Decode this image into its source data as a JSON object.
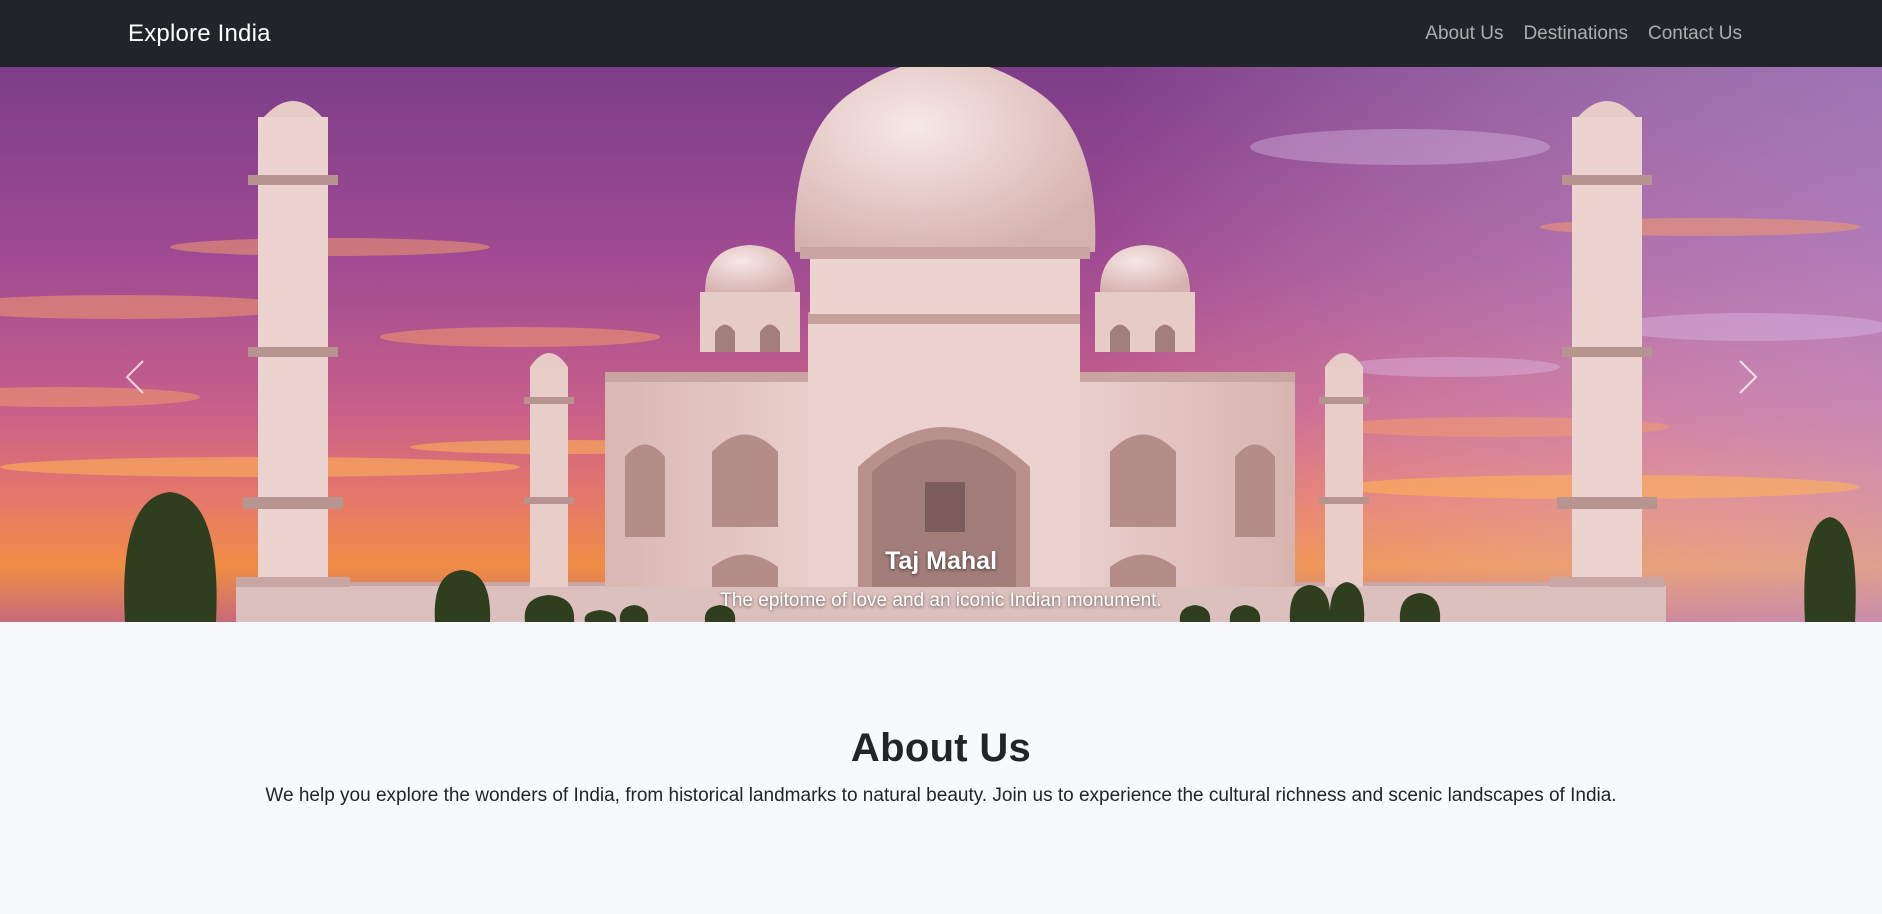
{
  "navbar": {
    "brand": "Explore India",
    "links": [
      "About Us",
      "Destinations",
      "Contact Us"
    ]
  },
  "carousel": {
    "slide": {
      "title": "Taj Mahal",
      "text": "The epitome of love and an iconic Indian monument."
    },
    "prev_icon": "chevron-left-icon",
    "next_icon": "chevron-right-icon"
  },
  "about": {
    "heading": "About Us",
    "text": "We help you explore the wonders of India, from historical landmarks to natural beauty. Join us to experience the cultural richness and scenic landscapes of India."
  },
  "colors": {
    "navbar_bg": "#212529",
    "page_bg": "#f8f9fa",
    "sky_top": "#7a3f86",
    "sky_glow": "#f08a3a",
    "marble": "#f2dcd8"
  }
}
